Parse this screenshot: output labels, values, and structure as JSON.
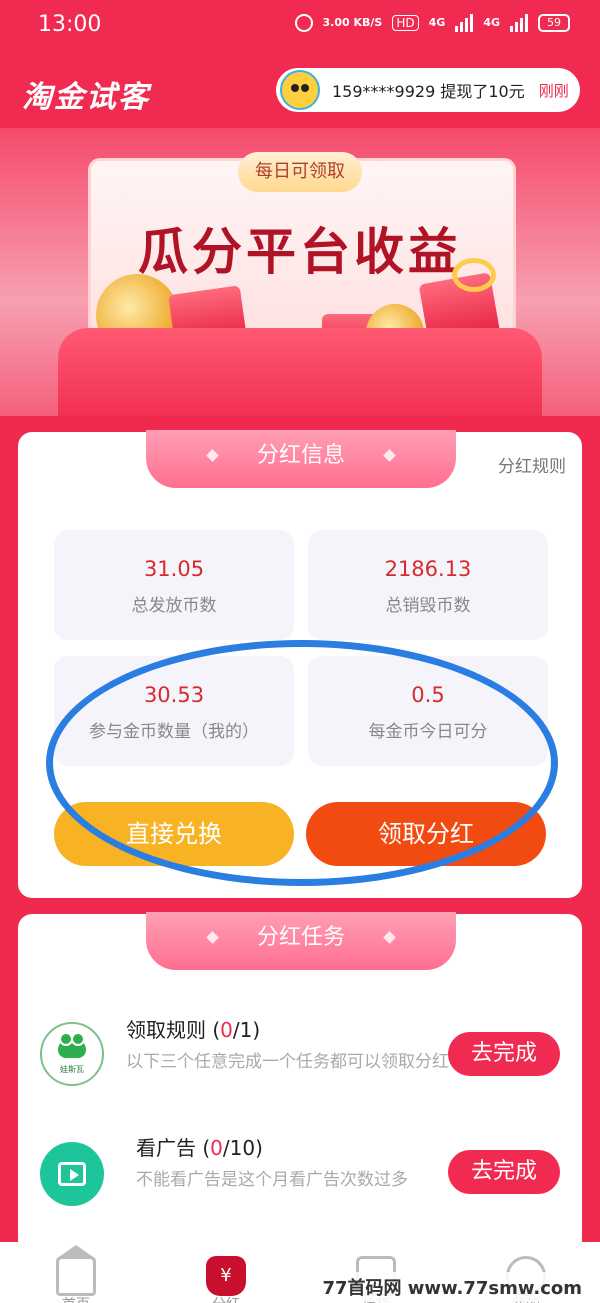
{
  "status_bar": {
    "time": "13:00",
    "speed": "3.00 KB/S",
    "hd": "HD",
    "network1": "4G",
    "network2": "4G",
    "battery": "59"
  },
  "header": {
    "app_title": "淘金试客",
    "ticker_text": "159****9929 提现了10元",
    "ticker_tag": "刚刚"
  },
  "banner": {
    "pill": "每日可领取",
    "title": "瓜分平台收益"
  },
  "dividend_info": {
    "section_title": "分红信息",
    "rules_link": "分红规则",
    "stats": [
      {
        "value": "31.05",
        "label": "总发放币数"
      },
      {
        "value": "2186.13",
        "label": "总销毁币数"
      },
      {
        "value": "30.53",
        "label": "参与金币数量（我的）"
      },
      {
        "value": "0.5",
        "label": "每金币今日可分"
      }
    ],
    "exchange_button": "直接兑换",
    "claim_button": "领取分红"
  },
  "dividend_tasks": {
    "section_title": "分红任务",
    "tasks": [
      {
        "title": "领取规则 (",
        "progress_done": "0",
        "progress_total": "/1)",
        "desc": "以下三个任意完成一个任务都可以领取分红",
        "icon_text": "娃斯瓦",
        "button": "去完成"
      },
      {
        "title": "看广告 (",
        "progress_done": "0",
        "progress_total": "/10)",
        "desc": "不能看广告是这个月看广告次数过多",
        "button": "去完成"
      }
    ]
  },
  "bottom_nav": {
    "items": [
      {
        "label": "首页",
        "icon": "home-icon"
      },
      {
        "label": "分红",
        "icon": "money-bag-icon",
        "glyph": "¥"
      },
      {
        "label": "抢货",
        "icon": "shopping-bag-icon"
      },
      {
        "label": "我的",
        "icon": "profile-icon"
      }
    ]
  },
  "watermark": "77首码网 www.77smw.com",
  "colors": {
    "brand": "#f02a50",
    "exchange": "#f8b324",
    "claim": "#f24b12",
    "annotation": "#2a7de1"
  }
}
